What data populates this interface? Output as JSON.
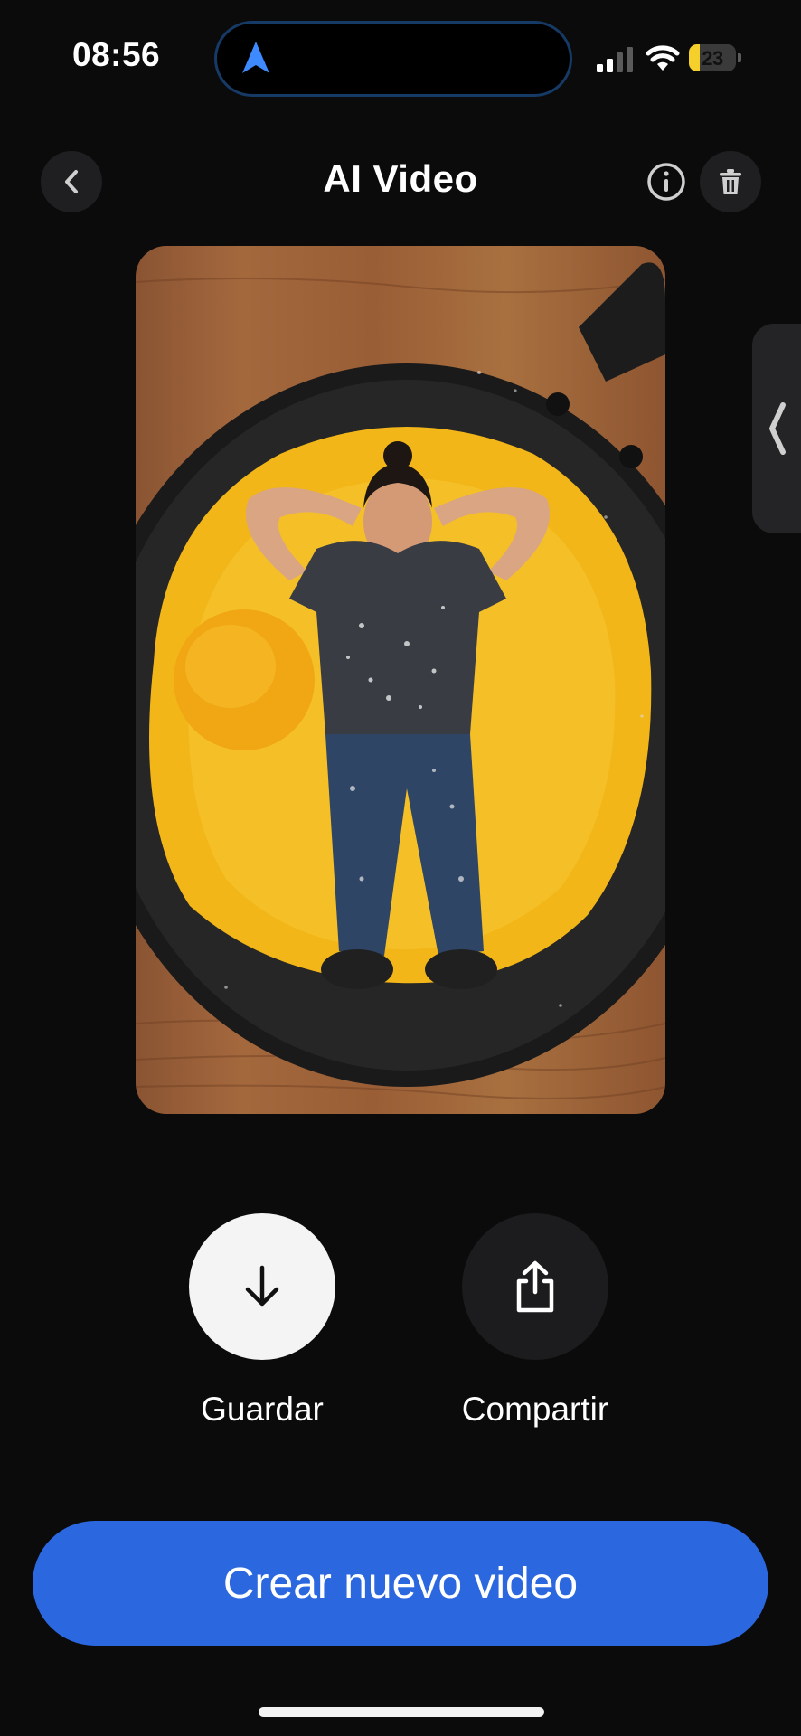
{
  "status_bar": {
    "time": "08:56",
    "battery": {
      "level_percent": 23,
      "label": "23",
      "charging": true,
      "color": "#f5d02a"
    },
    "icons": [
      "location-arrow-icon",
      "cellular-signal-icon",
      "wifi-icon",
      "battery-icon"
    ]
  },
  "header": {
    "title": "AI Video",
    "back_icon": "chevron-left-icon",
    "info_icon": "info-circle-icon",
    "delete_icon": "trash-icon"
  },
  "preview": {
    "description_icon": "video-thumbnail",
    "side_handle_icon": "chevron-left-icon"
  },
  "actions": {
    "save": {
      "label": "Guardar",
      "icon": "download-arrow-icon"
    },
    "share": {
      "label": "Compartir",
      "icon": "share-icon"
    }
  },
  "primary_button": {
    "label": "Crear nuevo video",
    "color": "#2b68e0"
  },
  "theme": {
    "background": "#0b0b0c",
    "accent": "#2b68e0"
  }
}
